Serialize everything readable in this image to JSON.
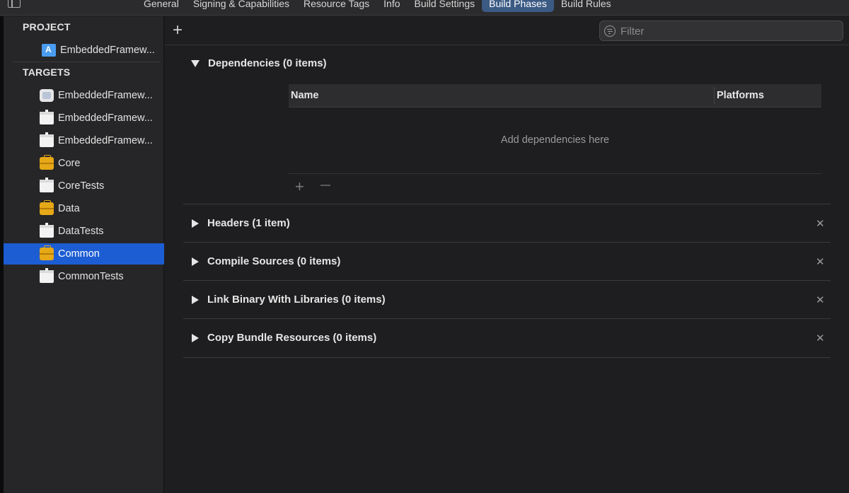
{
  "tabs": [
    "General",
    "Signing & Capabilities",
    "Resource Tags",
    "Info",
    "Build Settings",
    "Build Phases",
    "Build Rules"
  ],
  "active_tab": "Build Phases",
  "sidebar": {
    "project_header": "PROJECT",
    "project_item": "EmbeddedFramew...",
    "targets_header": "TARGETS",
    "targets": [
      {
        "label": "EmbeddedFramew...",
        "icon": "app-icon"
      },
      {
        "label": "EmbeddedFramew...",
        "icon": "bundle-icon"
      },
      {
        "label": "EmbeddedFramew...",
        "icon": "bundle-icon"
      },
      {
        "label": "Core",
        "icon": "framework-icon"
      },
      {
        "label": "CoreTests",
        "icon": "bundle-icon"
      },
      {
        "label": "Data",
        "icon": "framework-icon"
      },
      {
        "label": "DataTests",
        "icon": "bundle-icon"
      },
      {
        "label": "Common",
        "icon": "framework-icon"
      },
      {
        "label": "CommonTests",
        "icon": "bundle-icon"
      }
    ],
    "selected": "Common"
  },
  "toolbar": {
    "add_symbol": "+",
    "filter_placeholder": "Filter"
  },
  "phases": {
    "dependencies": {
      "title": "Dependencies (0 items)",
      "col_name": "Name",
      "col_platforms": "Platforms",
      "empty_text": "Add dependencies here",
      "add_symbol": "+"
    },
    "headers": {
      "title": "Headers (1 item)"
    },
    "compile_sources": {
      "title": "Compile Sources (0 items)"
    },
    "link_binary": {
      "title": "Link Binary With Libraries (0 items)"
    },
    "copy_bundle": {
      "title": "Copy Bundle Resources (0 items)"
    },
    "close_symbol": "✕"
  },
  "colors": {
    "selection": "#1d5dd3",
    "active_tab": "#3b5a84",
    "framework_icon": "#e6a817"
  }
}
